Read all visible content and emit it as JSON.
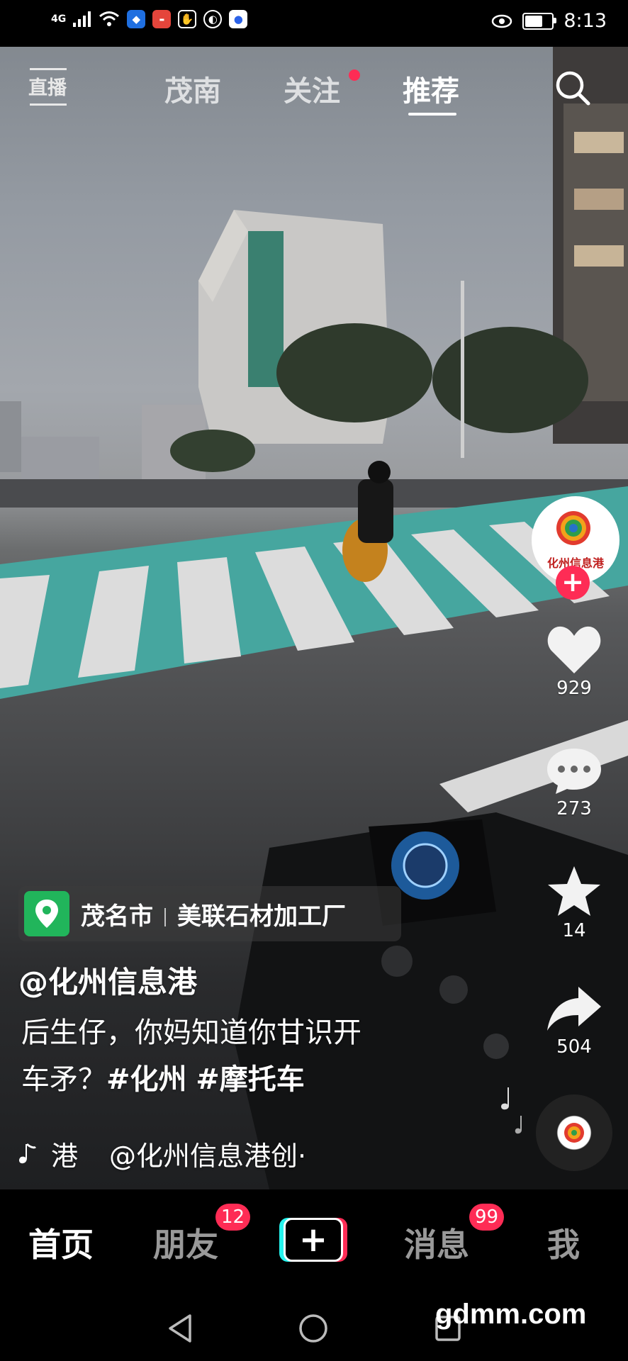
{
  "status_bar": {
    "network": "4G",
    "time": "8:13",
    "icons": [
      "signal-icon",
      "wifi-icon",
      "shield-app-icon",
      "huawei-app-icon",
      "hand-app-icon",
      "globe-app-icon",
      "baidu-app-icon",
      "eye-icon",
      "battery-icon"
    ]
  },
  "top_nav": {
    "live_label": "直播",
    "tabs": [
      {
        "label": "茂南",
        "active": false
      },
      {
        "label": "关注",
        "active": false,
        "dot": true
      },
      {
        "label": "推荐",
        "active": true
      }
    ]
  },
  "side_actions": {
    "avatar_text": "化州信息港",
    "likes": "929",
    "comments": "273",
    "favorites": "14",
    "shares": "504"
  },
  "location": {
    "city": "茂名市",
    "place": "美联石材加工厂"
  },
  "post": {
    "author": "@化州信息港",
    "caption_line1": "后生仔，你妈知道你甘识开",
    "caption_line2_text": "车矛？",
    "tag1": "#化州",
    "tag2": "#摩托车",
    "music_prefix": "港",
    "music_text": "@化州信息港创·"
  },
  "bottom_nav": {
    "items": [
      {
        "label": "首页",
        "active": true
      },
      {
        "label": "朋友",
        "badge": "12"
      },
      {
        "label": "消息",
        "badge": "99"
      },
      {
        "label": "我"
      }
    ]
  },
  "watermark": "gdmm.com",
  "colors": {
    "accent": "#fe2c55",
    "cyan": "#25f4ee",
    "location_green": "#21b55b"
  }
}
